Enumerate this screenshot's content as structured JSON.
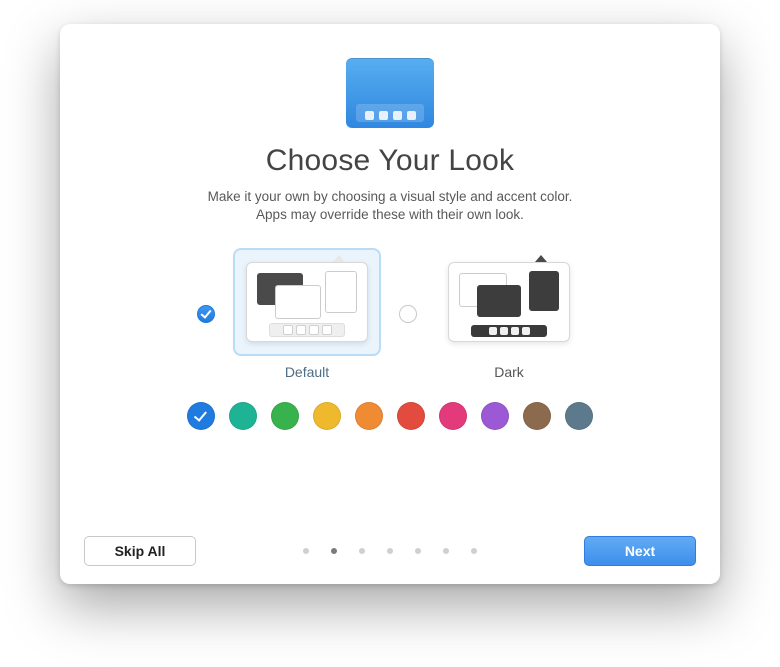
{
  "header": {
    "title": "Choose Your Look",
    "subtitle_line1": "Make it your own by choosing a visual style and accent color.",
    "subtitle_line2": "Apps may override these with their own look."
  },
  "themes": {
    "selected": "default",
    "options": [
      {
        "id": "default",
        "label": "Default"
      },
      {
        "id": "dark",
        "label": "Dark"
      }
    ]
  },
  "accent_colors": {
    "selected_index": 0,
    "items": [
      {
        "name": "blue",
        "hex": "#1f7be0"
      },
      {
        "name": "teal",
        "hex": "#1fb396"
      },
      {
        "name": "green",
        "hex": "#38b24c"
      },
      {
        "name": "yellow",
        "hex": "#efb92e"
      },
      {
        "name": "orange",
        "hex": "#ef8b33"
      },
      {
        "name": "red",
        "hex": "#e24b3e"
      },
      {
        "name": "pink",
        "hex": "#e23a7a"
      },
      {
        "name": "purple",
        "hex": "#9b59d6"
      },
      {
        "name": "brown",
        "hex": "#8c6a4e"
      },
      {
        "name": "slate",
        "hex": "#5d7a8c"
      }
    ]
  },
  "pager": {
    "total": 7,
    "current_index": 1
  },
  "footer": {
    "skip_label": "Skip All",
    "next_label": "Next"
  }
}
